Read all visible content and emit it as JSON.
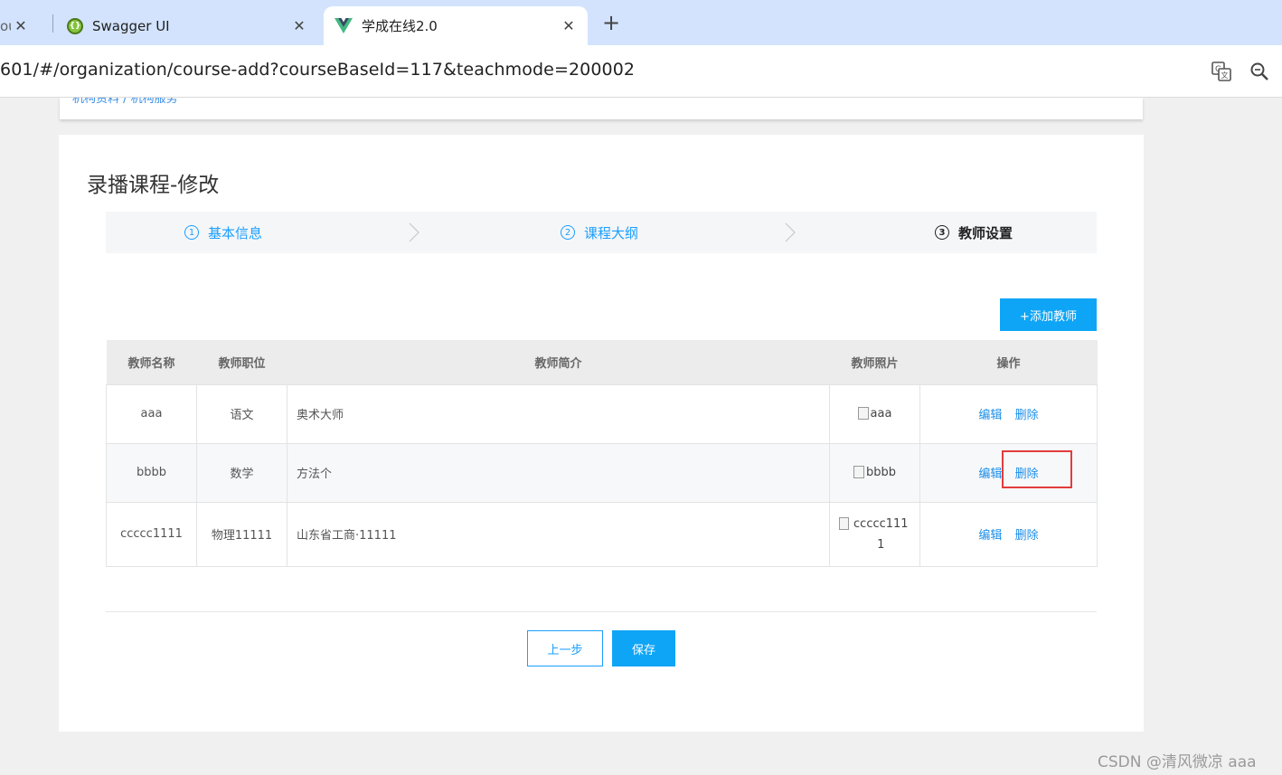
{
  "browser": {
    "tabs": [
      {
        "title": "ou",
        "close": "✕"
      },
      {
        "title": "Swagger UI",
        "close": "✕"
      },
      {
        "title": "学成在线2.0",
        "close": "✕"
      }
    ],
    "new_tab": "+",
    "url": "601/#/organization/course-add?courseBaseId=117&teachmode=200002"
  },
  "breadcrumb": "机构资料    /    机构服务",
  "page": {
    "title": "录播课程-修改",
    "steps": [
      {
        "num": "1",
        "label": "基本信息"
      },
      {
        "num": "2",
        "label": "课程大纲"
      },
      {
        "num": "3",
        "label": "教师设置"
      }
    ],
    "add_button": "+添加教师",
    "table": {
      "headers": [
        "教师名称",
        "教师职位",
        "教师简介",
        "教师照片",
        "操作"
      ],
      "rows": [
        {
          "name": "aaa",
          "position": "语文",
          "intro": "奥术大师",
          "photo_alt": "aaa",
          "edit": "编辑",
          "delete": "删除"
        },
        {
          "name": "bbbb",
          "position": "数学",
          "intro": "方法个",
          "photo_alt": "bbbb",
          "edit": "编辑",
          "delete": "删除"
        },
        {
          "name": "ccccc1111",
          "position": "物理11111",
          "intro": "山东省工商·11111",
          "photo_alt": "ccccc1111",
          "edit": "编辑",
          "delete": "删除"
        }
      ]
    },
    "prev_button": "上一步",
    "save_button": "保存"
  },
  "watermark": "CSDN @清风微凉 aaa",
  "colors": {
    "accent": "#0fa5f6",
    "link": "#1a8eea",
    "highlight": "#e23c3c",
    "tabbar": "#d3e3fd"
  }
}
